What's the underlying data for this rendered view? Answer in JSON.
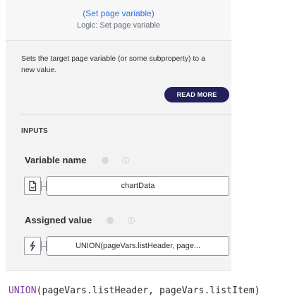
{
  "header": {
    "title": "(Set page variable)",
    "subtitle": "Logic: Set page variable"
  },
  "description": {
    "text": "Sets the target page variable (or some subproperty) to a new value."
  },
  "actions": {
    "read_more": "READ MORE"
  },
  "inputs": {
    "section_label": "INPUTS",
    "fields": [
      {
        "label": "Variable name",
        "icon": "document-icon",
        "value": "chartData"
      },
      {
        "label": "Assigned value",
        "icon": "lightning-icon",
        "value": "UNION(pageVars.listHeader, page..."
      }
    ]
  },
  "footer": {
    "code_func": "UNION",
    "code_rest": "(pageVars.listHeader, pageVars.listItem)"
  },
  "colors": {
    "panel_bg": "#f3f3f4",
    "link_blue": "#2d6fd6",
    "button_navy": "#23205b",
    "code_purple": "#7e3aa6"
  }
}
